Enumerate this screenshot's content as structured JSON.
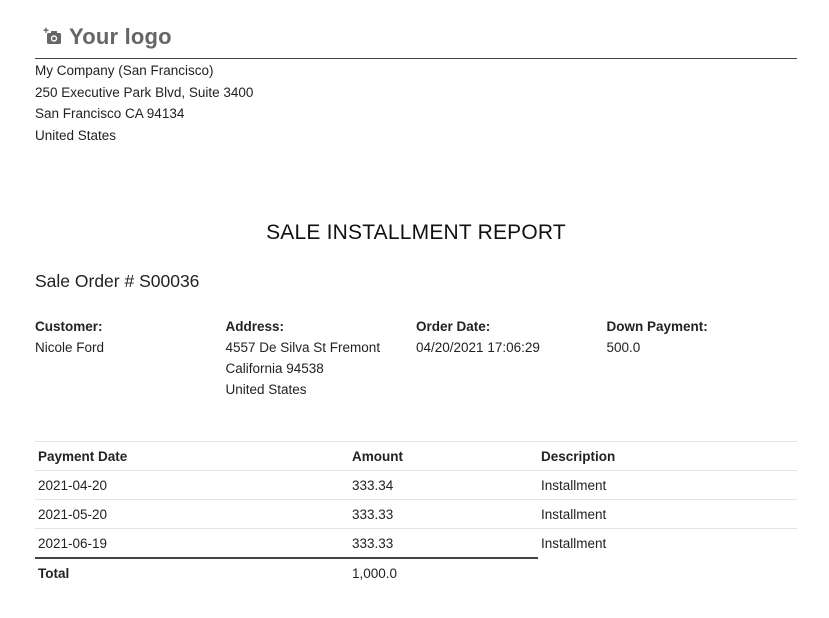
{
  "header": {
    "logo_text": "Your logo",
    "logo_icon": "camera-plus-icon"
  },
  "company": {
    "name": "My Company (San Francisco)",
    "street": "250 Executive Park Blvd, Suite 3400",
    "city_line": "San Francisco CA 94134",
    "country": "United States"
  },
  "report": {
    "title": "SALE INSTALLMENT REPORT",
    "order_title": "Sale Order # S00036"
  },
  "info": {
    "customer_label": "Customer:",
    "customer_value": "Nicole Ford",
    "address_label": "Address:",
    "address_lines": [
      "4557 De Silva St Fremont",
      "California 94538",
      "United States"
    ],
    "order_date_label": "Order Date:",
    "order_date_value": "04/20/2021 17:06:29",
    "down_payment_label": "Down Payment:",
    "down_payment_value": "500.0"
  },
  "table": {
    "headers": [
      "Payment Date",
      "Amount",
      "Description"
    ],
    "rows": [
      [
        "2021-04-20",
        "333.34",
        "Installment"
      ],
      [
        "2021-05-20",
        "333.33",
        "Installment"
      ],
      [
        "2021-06-19",
        "333.33",
        "Installment"
      ]
    ],
    "total_label": "Total",
    "total_value": "1,000.0"
  }
}
